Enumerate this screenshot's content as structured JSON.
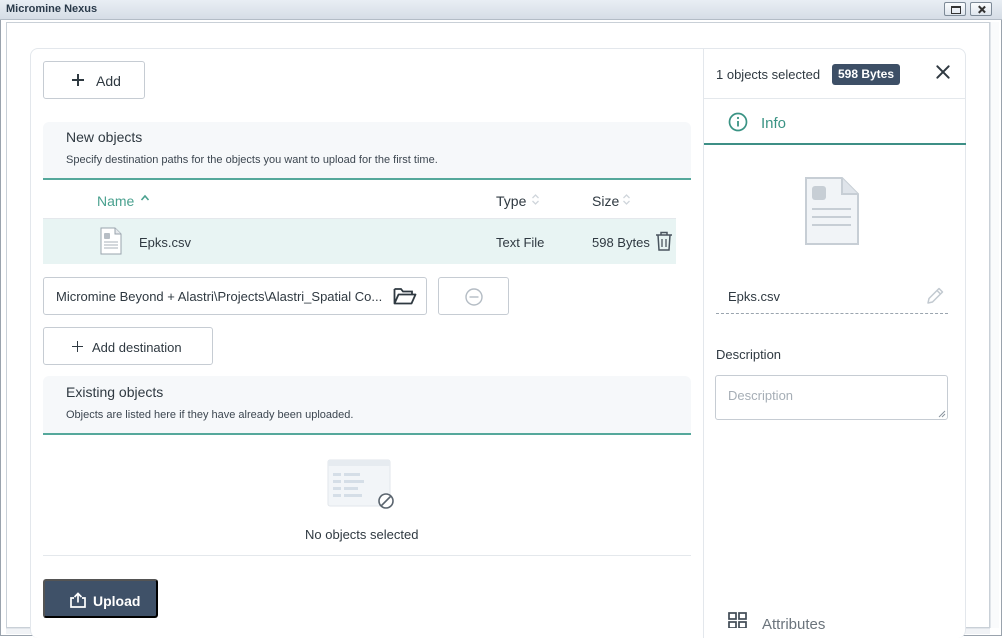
{
  "window": {
    "title": "Micromine Nexus"
  },
  "toolbar": {
    "add_label": "Add"
  },
  "new_objects": {
    "title": "New objects",
    "subtitle": "Specify destination paths for the objects you want to upload for the first time.",
    "columns": {
      "name": "Name",
      "type": "Type",
      "size": "Size"
    },
    "rows": [
      {
        "name": "Epks.csv",
        "type": "Text File",
        "size": "598 Bytes"
      }
    ]
  },
  "destination": {
    "path": "Micromine Beyond + Alastri\\Projects\\Alastri_Spatial Co...",
    "add_destination_label": "Add destination"
  },
  "existing_objects": {
    "title": "Existing objects",
    "subtitle": "Objects are listed here if they have already been uploaded.",
    "empty_text": "No objects selected"
  },
  "upload": {
    "label": "Upload"
  },
  "details": {
    "selected_count": "1 objects selected",
    "selected_size": "598 Bytes",
    "tabs": {
      "info": "Info",
      "attributes": "Attributes"
    },
    "file_name": "Epks.csv",
    "description_label": "Description",
    "description_placeholder": "Description"
  },
  "colors": {
    "accent": "#3a9384",
    "primary_button": "#3f5168",
    "badge": "#3d4f66"
  }
}
